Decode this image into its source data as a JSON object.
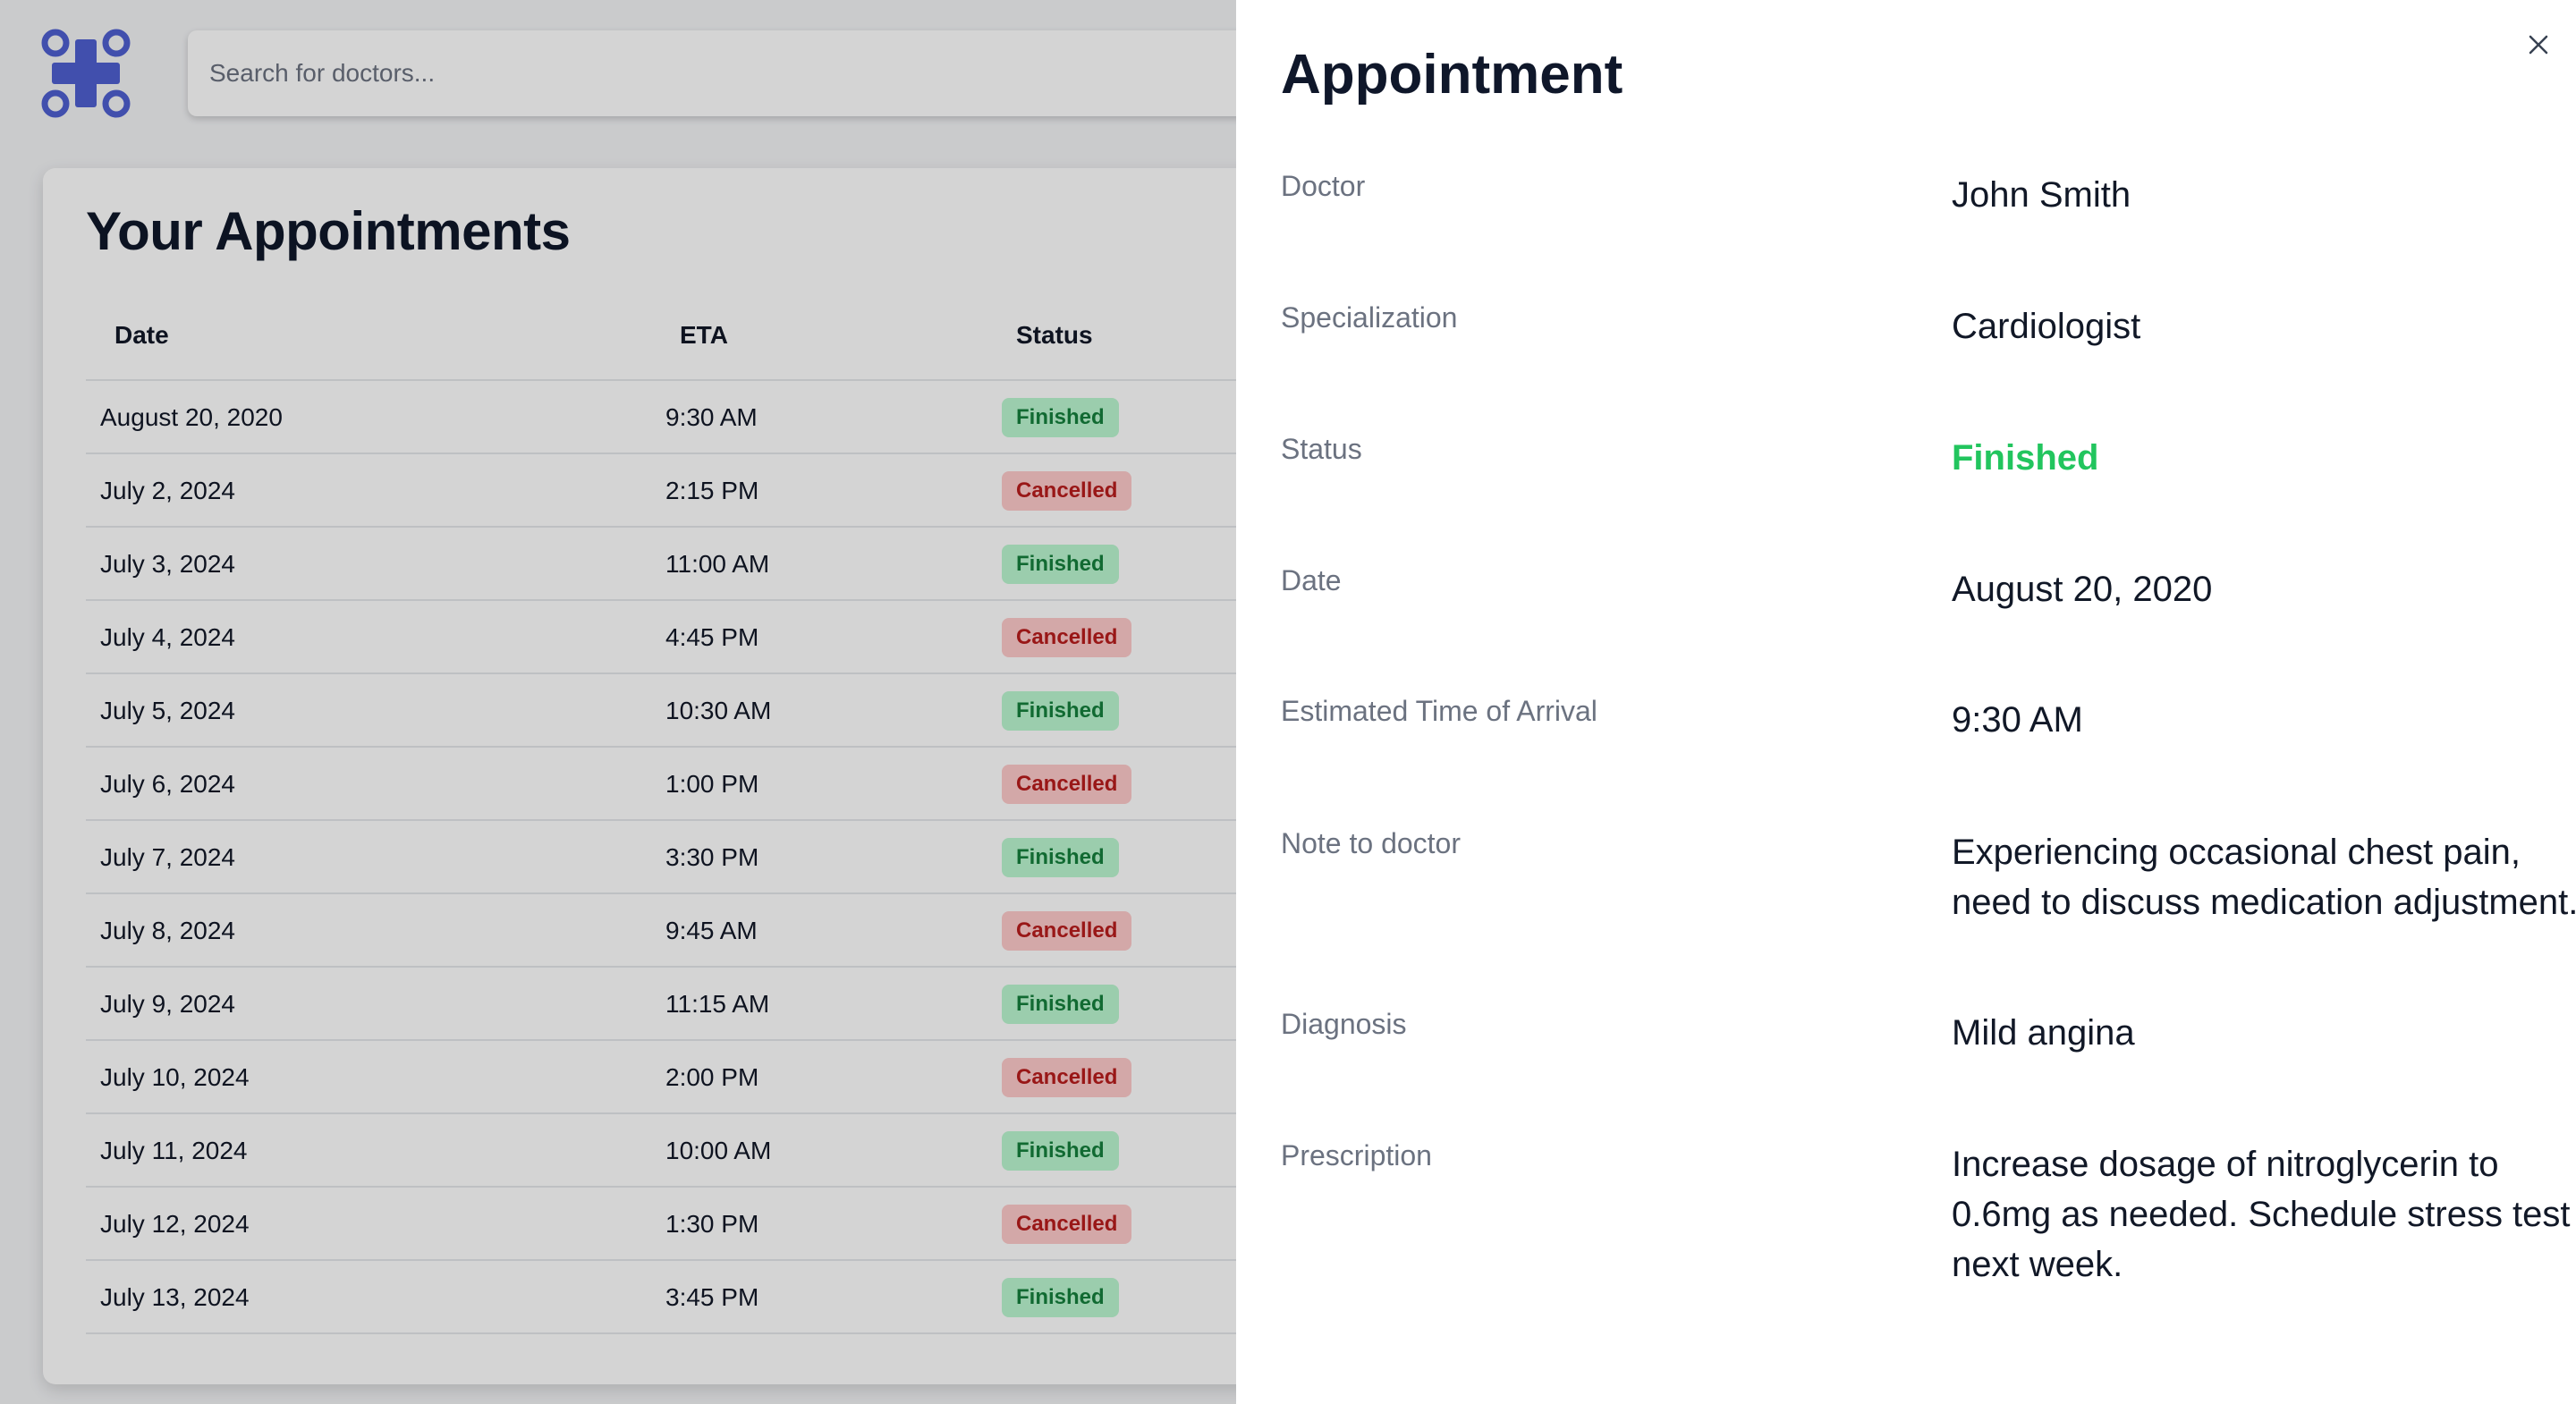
{
  "search": {
    "placeholder": "Search for doctors..."
  },
  "appointments": {
    "title": "Your Appointments",
    "columns": {
      "date": "Date",
      "eta": "ETA",
      "status": "Status"
    },
    "rows": [
      {
        "date": "August 20, 2020",
        "eta": "9:30 AM",
        "status": "Finished"
      },
      {
        "date": "July 2, 2024",
        "eta": "2:15 PM",
        "status": "Cancelled"
      },
      {
        "date": "July 3, 2024",
        "eta": "11:00 AM",
        "status": "Finished"
      },
      {
        "date": "July 4, 2024",
        "eta": "4:45 PM",
        "status": "Cancelled"
      },
      {
        "date": "July 5, 2024",
        "eta": "10:30 AM",
        "status": "Finished"
      },
      {
        "date": "July 6, 2024",
        "eta": "1:00 PM",
        "status": "Cancelled"
      },
      {
        "date": "July 7, 2024",
        "eta": "3:30 PM",
        "status": "Finished"
      },
      {
        "date": "July 8, 2024",
        "eta": "9:45 AM",
        "status": "Cancelled"
      },
      {
        "date": "July 9, 2024",
        "eta": "11:15 AM",
        "status": "Finished"
      },
      {
        "date": "July 10, 2024",
        "eta": "2:00 PM",
        "status": "Cancelled"
      },
      {
        "date": "July 11, 2024",
        "eta": "10:00 AM",
        "status": "Finished"
      },
      {
        "date": "July 12, 2024",
        "eta": "1:30 PM",
        "status": "Cancelled"
      },
      {
        "date": "July 13, 2024",
        "eta": "3:45 PM",
        "status": "Finished"
      }
    ]
  },
  "drawer": {
    "title": "Appointment",
    "close_icon": "close-icon",
    "doctor_label": "Doctor",
    "doctor": "John Smith",
    "specialization_label": "Specialization",
    "specialization": "Cardiologist",
    "status_label": "Status",
    "status": "Finished",
    "date_label": "Date",
    "date": "August 20, 2020",
    "eta_label": "Estimated Time of Arrival",
    "eta": "9:30 AM",
    "note_label": "Note to doctor",
    "note": "Experiencing occasional chest pain, need to discuss medication adjustment.",
    "diagnosis_label": "Diagnosis",
    "diagnosis": "Mild angina",
    "prescription_label": "Prescription",
    "prescription": "Increase dosage of nitroglycerin to 0.6mg as needed. Schedule stress test next week."
  },
  "colors": {
    "brand": "#4f5fd1",
    "finished_bg": "#bbf7d0",
    "finished_text": "#15803d",
    "cancelled_bg": "#fecaca",
    "cancelled_text": "#b91c1c",
    "status_finished": "#22c55e"
  }
}
